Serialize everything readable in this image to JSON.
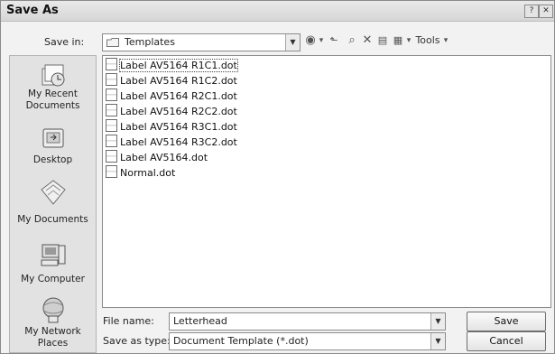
{
  "title": "Save As",
  "title_buttons": {
    "help": "?",
    "close": "✕"
  },
  "save_in": {
    "label": "Save in:",
    "value": "Templates"
  },
  "toolbar": {
    "tools_label": "Tools",
    "back": "◉",
    "dropdown": "▾",
    "up": "⬑",
    "search": "⌕",
    "delete": "✕",
    "new_folder": "▤",
    "views": "▦"
  },
  "places": [
    {
      "label": "My Recent Documents"
    },
    {
      "label": "Desktop"
    },
    {
      "label": "My Documents"
    },
    {
      "label": "My Computer"
    },
    {
      "label": "My Network Places"
    }
  ],
  "files": [
    "Label AV5164 R1C1.dot",
    "Label AV5164 R1C2.dot",
    "Label AV5164 R2C1.dot",
    "Label AV5164 R2C2.dot",
    "Label AV5164 R3C1.dot",
    "Label AV5164 R3C2.dot",
    "Label AV5164.dot",
    "Normal.dot"
  ],
  "file_name": {
    "label": "File name:",
    "value": "Letterhead"
  },
  "save_as_type": {
    "label": "Save as type:",
    "value": "Document Template (*.dot)"
  },
  "buttons": {
    "save": "Save",
    "cancel": "Cancel"
  }
}
